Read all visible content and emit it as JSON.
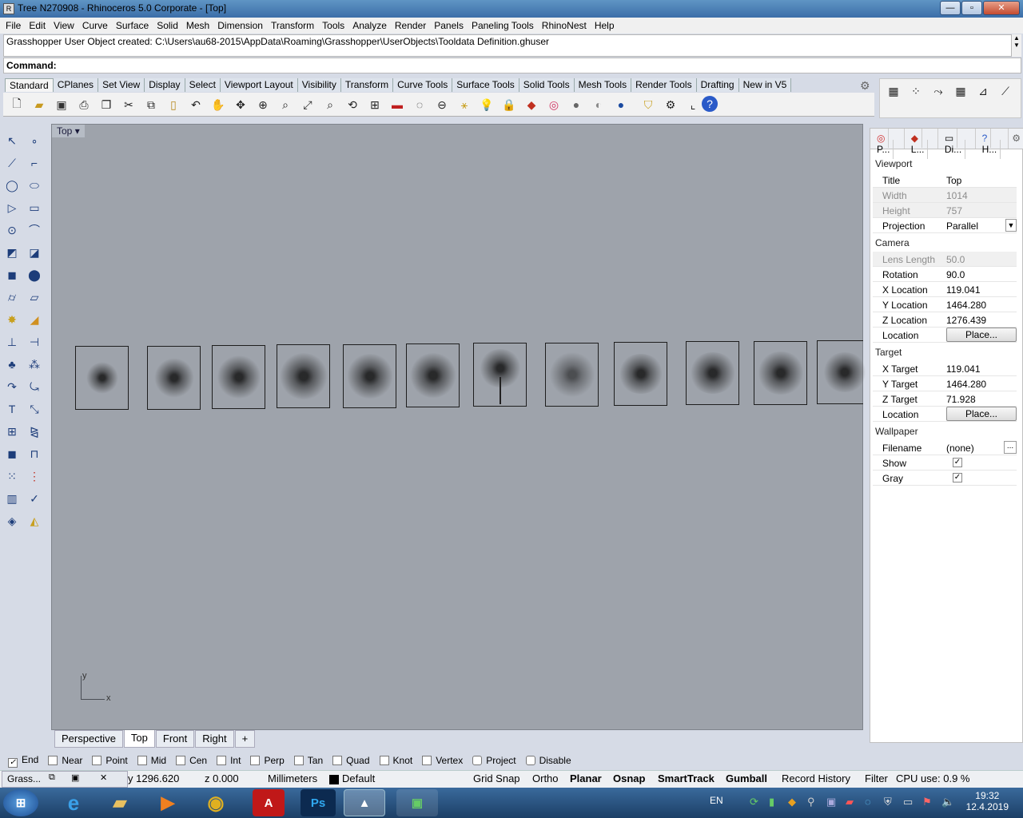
{
  "window": {
    "title": "Tree N270908 - Rhinoceros  5.0 Corporate - [Top]",
    "min": "—",
    "max": "▫",
    "close": "✕"
  },
  "menu": [
    "File",
    "Edit",
    "View",
    "Curve",
    "Surface",
    "Solid",
    "Mesh",
    "Dimension",
    "Transform",
    "Tools",
    "Analyze",
    "Render",
    "Panels",
    "Paneling Tools",
    "RhinoNest",
    "Help"
  ],
  "history": "Grasshopper User Object created: C:\\Users\\au68-2015\\AppData\\Roaming\\Grasshopper\\UserObjects\\Tooldata Definition.ghuser",
  "command": {
    "label": "Command:"
  },
  "toolbar_tabs": [
    "Standard",
    "CPlanes",
    "Set View",
    "Display",
    "Select",
    "Viewport Layout",
    "Visibility",
    "Transform",
    "Curve Tools",
    "Surface Tools",
    "Solid Tools",
    "Mesh Tools",
    "Render Tools",
    "Drafting",
    "New in V5"
  ],
  "viewport": {
    "label": "Top",
    "axis_y": "y",
    "axis_x": "x",
    "bg": "#9ea3ab"
  },
  "viewport_tabs": [
    "Perspective",
    "Top",
    "Front",
    "Right",
    "+"
  ],
  "panel": {
    "tabs": [
      "P...",
      "L...",
      "Di...",
      "H..."
    ],
    "viewport_title": "Viewport",
    "camera_title": "Camera",
    "target_title": "Target",
    "wallpaper_title": "Wallpaper",
    "rows": {
      "title_k": "Title",
      "title_v": "Top",
      "width_k": "Width",
      "width_v": "1014",
      "height_k": "Height",
      "height_v": "757",
      "proj_k": "Projection",
      "proj_v": "Parallel",
      "lens_k": "Lens Length",
      "lens_v": "50.0",
      "rot_k": "Rotation",
      "rot_v": "90.0",
      "xloc_k": "X Location",
      "xloc_v": "119.041",
      "yloc_k": "Y Location",
      "yloc_v": "1464.280",
      "zloc_k": "Z Location",
      "zloc_v": "1276.439",
      "loc_k": "Location",
      "loc_btn": "Place...",
      "xt_k": "X Target",
      "xt_v": "119.041",
      "yt_k": "Y Target",
      "yt_v": "1464.280",
      "zt_k": "Z Target",
      "zt_v": "71.928",
      "tloc_k": "Location",
      "tloc_btn": "Place...",
      "file_k": "Filename",
      "file_v": "(none)",
      "file_btn": "...",
      "show_k": "Show",
      "gray_k": "Gray"
    }
  },
  "osnap": [
    "End",
    "Near",
    "Point",
    "Mid",
    "Cen",
    "Int",
    "Perp",
    "Tan",
    "Quad",
    "Knot",
    "Vertex",
    "Project",
    "Disable"
  ],
  "status": {
    "gh": "Grass...",
    "y": "y 1296.620",
    "z": "z 0.000",
    "units": "Millimeters",
    "layer": "Default",
    "grid": "Grid Snap",
    "ortho": "Ortho",
    "planar": "Planar",
    "osnap": "Osnap",
    "smarttrack": "SmartTrack",
    "gumball": "Gumball",
    "record": "Record History",
    "filter": "Filter",
    "cpu": "CPU use: 0.9 %"
  },
  "taskbar": {
    "lang": "EN",
    "time": "19:32",
    "date": "12.4.2019"
  }
}
